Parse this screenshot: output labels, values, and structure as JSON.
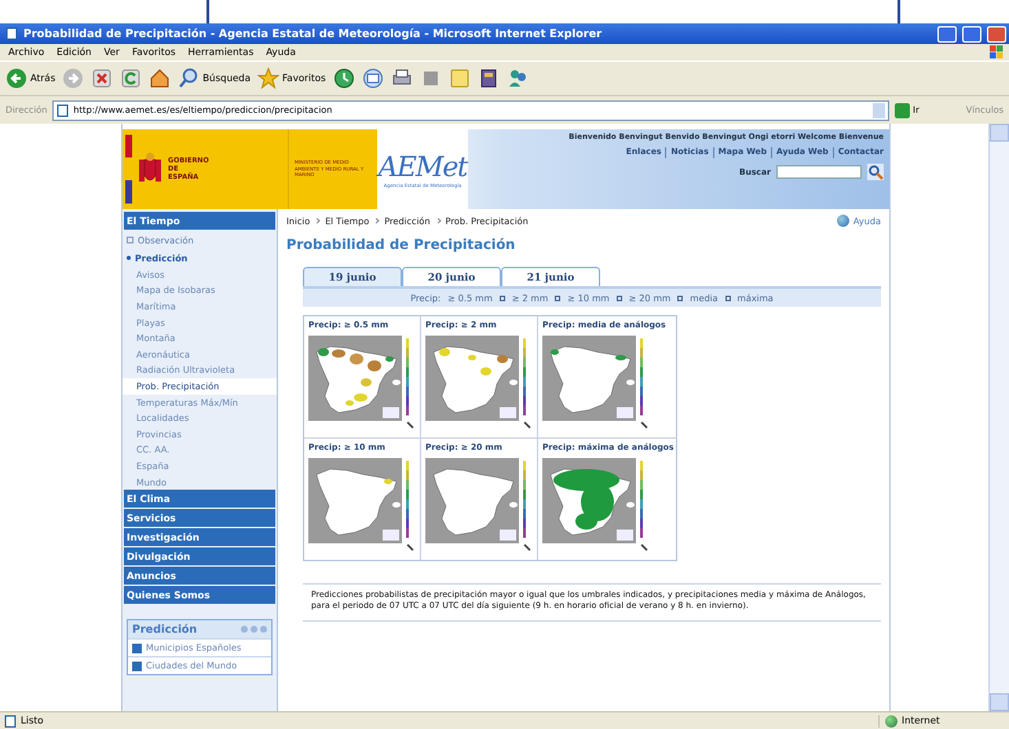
{
  "window": {
    "title": "Probabilidad de Precipitación - Agencia Estatal de Meteorología - Microsoft Internet Explorer"
  },
  "menu": [
    "Archivo",
    "Edición",
    "Ver",
    "Favoritos",
    "Herramientas",
    "Ayuda"
  ],
  "toolbar": [
    {
      "kind": "back",
      "label": "Atrás"
    },
    {
      "kind": "forward"
    },
    {
      "kind": "stop"
    },
    {
      "kind": "refresh"
    },
    {
      "kind": "home"
    },
    {
      "kind": "search",
      "label": "Búsqueda"
    },
    {
      "kind": "favorites",
      "label": "Favoritos"
    },
    {
      "kind": "history"
    },
    {
      "kind": "mail"
    },
    {
      "kind": "print"
    },
    {
      "kind": "halt"
    },
    {
      "kind": "note"
    },
    {
      "kind": "book"
    },
    {
      "kind": "messenger"
    }
  ],
  "address": {
    "label": "Dirección",
    "url": "http://www.aemet.es/es/eltiempo/prediccion/precipitacion",
    "go": "Ir",
    "links": "Vínculos"
  },
  "site_header": {
    "government": "GOBIERNO DE ESPAÑA",
    "ministry": "MINISTERIO DE MEDIO AMBIENTE Y MEDIO RURAL Y MARINO",
    "logo": "AEMet",
    "agency": "Agencia Estatal de Meteorología",
    "welcome": "Bienvenido Benvingut Benvido Benvingut Ongi etorri Welcome Bienvenue",
    "links": [
      "Enlaces",
      "Noticias",
      "Mapa Web",
      "Ayuda Web",
      "Contactar"
    ],
    "search_label": "Buscar"
  },
  "sidebar": {
    "sections": [
      {
        "label": "El Tiempo",
        "expanded": true,
        "children": [
          {
            "label": "Observación",
            "expanded": false
          },
          {
            "label": "Predicción",
            "expanded": true,
            "children": [
              {
                "label": "Avisos",
                "selected": false
              },
              {
                "label": "Mapa de Isobaras",
                "selected": false
              },
              {
                "label": "Marítima",
                "selected": false
              },
              {
                "label": "Playas",
                "selected": false
              },
              {
                "label": "Montaña",
                "selected": false
              },
              {
                "label": "Aeronáutica",
                "selected": false
              },
              {
                "label": "Radiación Ultravioleta",
                "selected": false
              },
              {
                "label": "Prob. Precipitación",
                "selected": true
              },
              {
                "label": "Temperaturas Máx/Mín",
                "selected": false
              },
              {
                "label": "Localidades",
                "selected": false
              },
              {
                "label": "Provincias",
                "selected": false
              },
              {
                "label": "CC. AA.",
                "selected": false
              },
              {
                "label": "España",
                "selected": false
              },
              {
                "label": "Mundo",
                "selected": false
              }
            ]
          }
        ]
      },
      {
        "label": "El Clima",
        "expanded": false
      },
      {
        "label": "Servicios",
        "expanded": false
      },
      {
        "label": "Investigación",
        "expanded": false
      },
      {
        "label": "Divulgación",
        "expanded": false
      },
      {
        "label": "Anuncios",
        "expanded": false
      },
      {
        "label": "Quienes Somos",
        "expanded": false
      }
    ]
  },
  "prediction_box": {
    "title": "Predicción",
    "links": [
      "Municipios Españoles",
      "Ciudades del Mundo"
    ]
  },
  "breadcrumb": [
    "Inicio",
    "El Tiempo",
    "Predicción",
    "Prob. Precipitación"
  ],
  "help": "Ayuda",
  "title": "Probabilidad de Precipitación",
  "tabs": [
    {
      "label": "19 junio",
      "selected": true
    },
    {
      "label": "20 junio",
      "selected": false
    },
    {
      "label": "21 junio",
      "selected": false
    }
  ],
  "filter": {
    "label": "Precip:",
    "options": [
      "≥ 0.5 mm",
      "≥ 2 mm",
      "≥ 10 mm",
      "≥ 20 mm",
      "media",
      "máxima"
    ]
  },
  "maps": [
    {
      "title": "Precip: ≥ 0.5 mm"
    },
    {
      "title": "Precip: ≥ 2 mm"
    },
    {
      "title": "Precip: media de análogos"
    },
    {
      "title": "Precip: ≥ 10 mm"
    },
    {
      "title": "Precip: ≥ 20 mm"
    },
    {
      "title": "Precip: máxima de análogos"
    }
  ],
  "description": "Predicciones probabilistas de precipitación mayor o igual que los umbrales indicados, y precipitaciones media y máxima de Análogos, para el periodo de 07 UTC a 07 UTC del día siguiente (9 h. en horario oficial de verano y 8 h. en invierno).",
  "status_bar": {
    "text": "Listo",
    "zone": "Internet"
  }
}
